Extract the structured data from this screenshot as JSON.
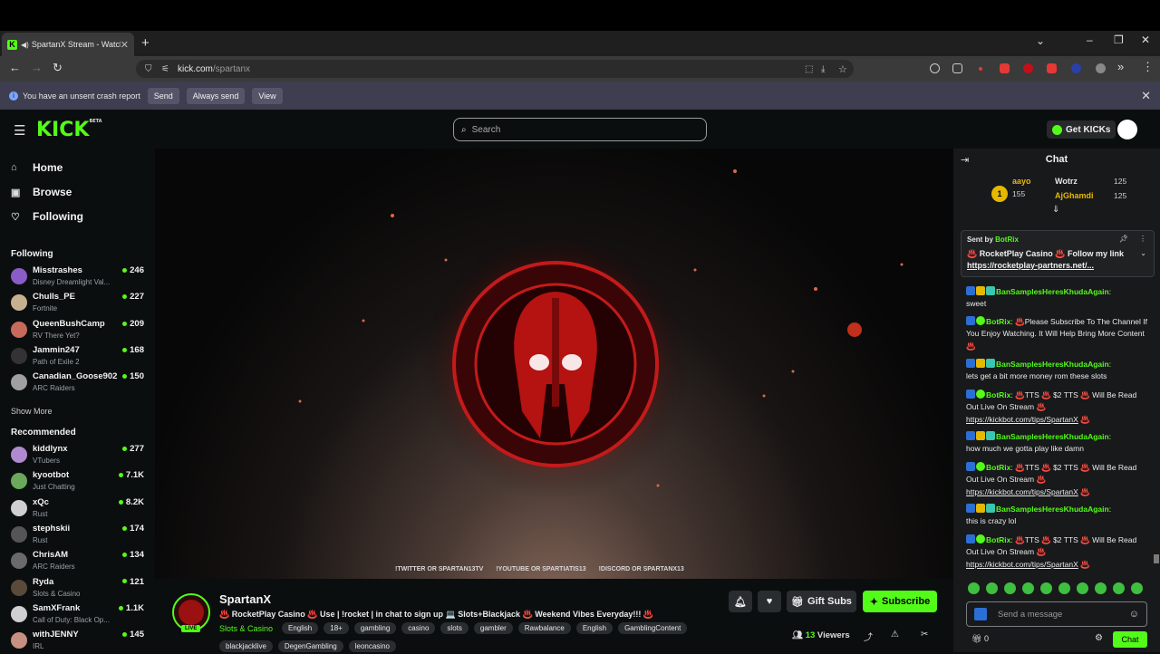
{
  "browser": {
    "tab_title": "SpartanX Stream - Watch Li",
    "tab_close": "✕",
    "new_tab": "+",
    "url_host": "kick.com",
    "url_path": "/spartanx",
    "crash": {
      "message": "You have an unsent crash report",
      "send": "Send",
      "always_send": "Always send",
      "view": "View"
    }
  },
  "header": {
    "logo": "KICK",
    "logo_beta": "BETA",
    "search_placeholder": "Search",
    "get_kicks": "Get KICKs"
  },
  "sidebar": {
    "nav": [
      {
        "label": "Home",
        "icon": "home-icon"
      },
      {
        "label": "Browse",
        "icon": "browse-icon"
      },
      {
        "label": "Following",
        "icon": "heart-icon"
      }
    ],
    "following_title": "Following",
    "following": [
      {
        "name": "Misstrashes",
        "category": "Disney Dreamlight Val...",
        "viewers": "246",
        "color": "#8a5cc7"
      },
      {
        "name": "Chulls_PE",
        "category": "Fortnite",
        "viewers": "227",
        "color": "#c7b090"
      },
      {
        "name": "QueenBushCamp",
        "category": "RV There Yet?",
        "viewers": "209",
        "color": "#c76a5c"
      },
      {
        "name": "Jammin247",
        "category": "Path of Exile 2",
        "viewers": "168",
        "color": "#333333"
      },
      {
        "name": "Canadian_Goose902",
        "category": "ARC Raiders",
        "viewers": "150",
        "color": "#a0a0a0"
      }
    ],
    "show_more": "Show More",
    "recommended_title": "Recommended",
    "recommended": [
      {
        "name": "kiddlynx",
        "category": "VTubers",
        "viewers": "277",
        "color": "#b08ad0"
      },
      {
        "name": "kyootbot",
        "category": "Just Chatting",
        "viewers": "7.1K",
        "color": "#6aa85c"
      },
      {
        "name": "xQc",
        "category": "Rust",
        "viewers": "8.2K",
        "color": "#d0d0d0"
      },
      {
        "name": "stephskii",
        "category": "Rust",
        "viewers": "174",
        "color": "#555555"
      },
      {
        "name": "ChrisAM",
        "category": "ARC Raiders",
        "viewers": "134",
        "color": "#6a6a6a"
      },
      {
        "name": "Ryda",
        "category": "Slots & Casino",
        "viewers": "121",
        "color": "#5a4a3a"
      },
      {
        "name": "SamXFrank",
        "category": "Call of Duty: Black Op...",
        "viewers": "1.1K",
        "color": "#cfcfcf"
      },
      {
        "name": "withJENNY",
        "category": "IRL",
        "viewers": "145",
        "color": "#c79080"
      }
    ]
  },
  "player": {
    "socials": [
      "!TWITTER OR SPARTAN13TV",
      "!YOUTUBE OR SPARTIATIS13",
      "!DISCORD OR SPARTANX13"
    ]
  },
  "stream": {
    "live_badge": "LIVE",
    "name": "SpartanX",
    "title": "♨️ RocketPlay Casino ♨️ Use | !rocket | in chat to sign up 💻 Slots+Blackjack ♨️ Weekend Vibes Everyday!!! ♨️",
    "category": "Slots & Casino",
    "tags": [
      "English",
      "18+",
      "gambling",
      "casino",
      "slots",
      "gambler",
      "Rawbalance",
      "English",
      "GamblingContent"
    ],
    "tags2": [
      "blackjacklive",
      "DegenGambling",
      "leoncasino"
    ],
    "gift_subs": "Gift Subs",
    "subscribe": "Subscribe",
    "viewers_count": "13",
    "viewers_label": "Viewers"
  },
  "chat": {
    "title": "Chat",
    "leaderboard": [
      {
        "name": "aayo",
        "value": "155",
        "color": "#e6b800"
      },
      {
        "name": "Wotrz",
        "value": "125",
        "color": "#e6e6e6"
      },
      {
        "name": "AjGhamdi",
        "value": "125",
        "color": "#e6b800"
      }
    ],
    "pinned": {
      "sent_by_prefix": "Sent by",
      "sent_by": "BotRix",
      "message": "♨️ RocketPlay Casino ♨️ Follow my link",
      "link": "https://rocketplay-partners.net/..."
    },
    "messages": [
      {
        "user": "BanSamplesHeresKhudaAgain",
        "text": "sweet",
        "link": ""
      },
      {
        "user": "BotRix",
        "text": "♨️Please Subscribe To The Channel If You Enjoy Watching. It Will Help Bring More Content ♨️",
        "link": ""
      },
      {
        "user": "BanSamplesHeresKhudaAgain",
        "text": "lets get a bit more money rom these slots",
        "link": ""
      },
      {
        "user": "BotRix",
        "text": "♨️TTS ♨️ $2 TTS ♨️ Will Be Read Out Live On Stream ♨️",
        "link": "https://kickbot.com/tips/SpartanX"
      },
      {
        "user": "BanSamplesHeresKhudaAgain",
        "text": "how much we gotta play like damn",
        "link": ""
      },
      {
        "user": "BotRix",
        "text": "♨️TTS ♨️ $2 TTS ♨️ Will Be Read Out Live On Stream ♨️",
        "link": "https://kickbot.com/tips/SpartanX"
      },
      {
        "user": "BanSamplesHeresKhudaAgain",
        "text": "this is crazy lol",
        "link": ""
      },
      {
        "user": "BotRix",
        "text": "♨️TTS ♨️ $2 TTS ♨️ Will Be Read Out Live On Stream ♨️",
        "link": "https://kickbot.com/tips/SpartanX"
      }
    ],
    "input_placeholder": "Send a message",
    "kicks_count": "0",
    "send_label": "Chat"
  }
}
